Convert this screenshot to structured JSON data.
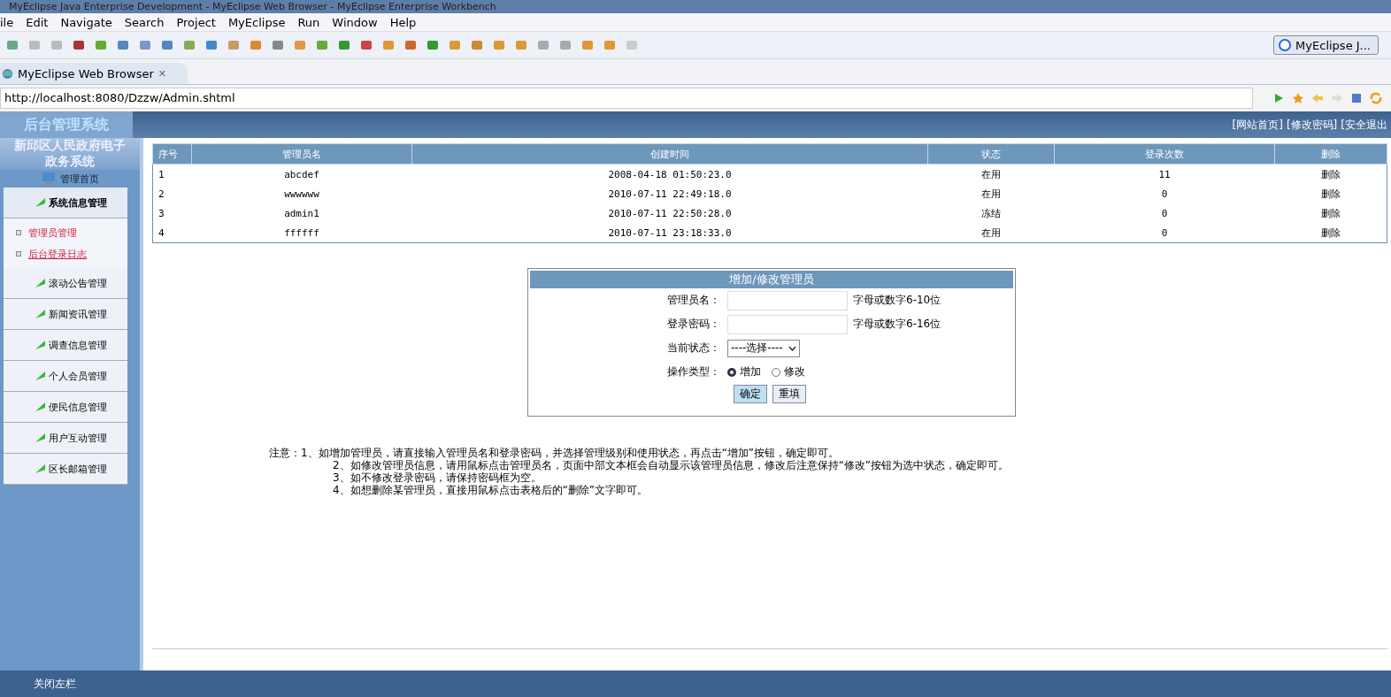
{
  "window": {
    "title": "MyEclipse Java Enterprise Development - MyEclipse Web Browser - MyEclipse Enterprise Workbench"
  },
  "menu": [
    "ile",
    "Edit",
    "Navigate",
    "Search",
    "Project",
    "MyEclipse",
    "Run",
    "Window",
    "Help"
  ],
  "perspective": {
    "label": "MyEclipse J..."
  },
  "editor_tab": {
    "label": "MyEclipse Web Browser",
    "close": "✕"
  },
  "address": {
    "value": "http://localhost:8080/Dzzw/Admin.shtml"
  },
  "header": {
    "logo": "后台管理系统",
    "links": [
      "[网站首页]",
      "[修改密码]",
      "[安全退出"
    ]
  },
  "sidebar": {
    "subtitle": "新邱区人民政府电子政务系统",
    "home": "管理首页",
    "items": [
      {
        "label": "系统信息管理",
        "expanded": true,
        "children": [
          {
            "label": "管理员管理",
            "hovered": false
          },
          {
            "label": "后台登录日志",
            "hovered": true
          }
        ]
      },
      {
        "label": "滚动公告管理",
        "expanded": false
      },
      {
        "label": "新闻资讯管理",
        "expanded": false
      },
      {
        "label": "调查信息管理",
        "expanded": false
      },
      {
        "label": "个人会员管理",
        "expanded": false
      },
      {
        "label": "便民信息管理",
        "expanded": false
      },
      {
        "label": "用户互动管理",
        "expanded": false
      },
      {
        "label": "区长邮箱管理",
        "expanded": false
      }
    ],
    "footer": "关闭左栏"
  },
  "table": {
    "columns": [
      "序号",
      "管理员名",
      "创建时间",
      "状态",
      "登录次数",
      "删除"
    ],
    "rows": [
      [
        "1",
        "abcdef",
        "2008-04-18 01:50:23.0",
        "在用",
        "11",
        "删除"
      ],
      [
        "2",
        "wwwwww",
        "2010-07-11 22:49:18.0",
        "在用",
        "0",
        "删除"
      ],
      [
        "3",
        "admin1",
        "2010-07-11 22:50:28.0",
        "冻结",
        "0",
        "删除"
      ],
      [
        "4",
        "ffffff",
        "2010-07-11 23:18:33.0",
        "在用",
        "0",
        "删除"
      ]
    ]
  },
  "form": {
    "title": "增加/修改管理员",
    "fields": [
      {
        "kind": "text",
        "label": "管理员名：",
        "hint": "字母或数字6-10位"
      },
      {
        "kind": "password",
        "label": "登录密码：",
        "hint": "字母或数字6-16位"
      },
      {
        "kind": "select",
        "label": "当前状态：",
        "value": "----选择----"
      },
      {
        "kind": "radio",
        "label": "操作类型：",
        "options": [
          {
            "label": "增加",
            "selected": true
          },
          {
            "label": "修改",
            "selected": false
          }
        ]
      }
    ],
    "buttons": [
      "确定",
      "重填"
    ]
  },
  "notes": {
    "label": "注意：",
    "lines": [
      "1、如增加管理员，请直接输入管理员名和登录密码，并选择管理级别和使用状态，再点击“增加”按钮，确定即可。",
      "2、如修改管理员信息，请用鼠标点击管理员名，页面中部文本框会自动显示该管理员信息，修改后注意保持“修改”按钮为选中状态，确定即可。",
      "3、如不修改登录密码，请保持密码框为空。",
      "4、如想删除某管理员，直接用鼠标点击表格后的“删除”文字即可。"
    ]
  }
}
